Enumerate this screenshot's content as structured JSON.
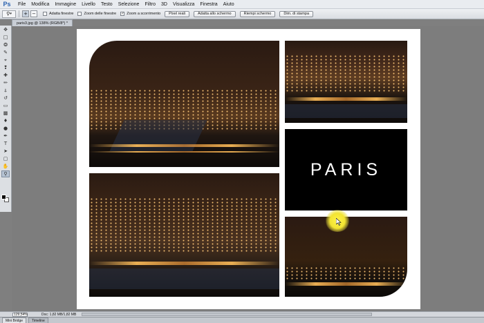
{
  "app": {
    "logo": "Ps"
  },
  "menu": [
    "File",
    "Modifica",
    "Immagine",
    "Livello",
    "Testo",
    "Selezione",
    "Filtro",
    "3D",
    "Visualizza",
    "Finestra",
    "Aiuto"
  ],
  "options": {
    "tool_icon": "zoom-icon",
    "checkboxes": [
      {
        "label": "Adatta finestre",
        "checked": false
      },
      {
        "label": "Zoom delle finestre",
        "checked": false
      },
      {
        "label": "Zoom a scorrimento",
        "checked": true
      }
    ],
    "buttons": [
      "Pixel reali",
      "Adatta allo schermo",
      "Riempi schermo",
      "Dim. di stampa"
    ]
  },
  "document": {
    "tab_label": "paris3.jpg @ 138% (RGB/8*) *",
    "paris_text": "PARIS"
  },
  "status": {
    "zoom": "129,54%",
    "doc_info": "Doc: 1,82 MB/1,82 MB"
  },
  "panels": [
    "Mini Bridge",
    "Timeline"
  ],
  "colors": {
    "accent": "#2a62b0",
    "highlight": "#f2e432"
  }
}
